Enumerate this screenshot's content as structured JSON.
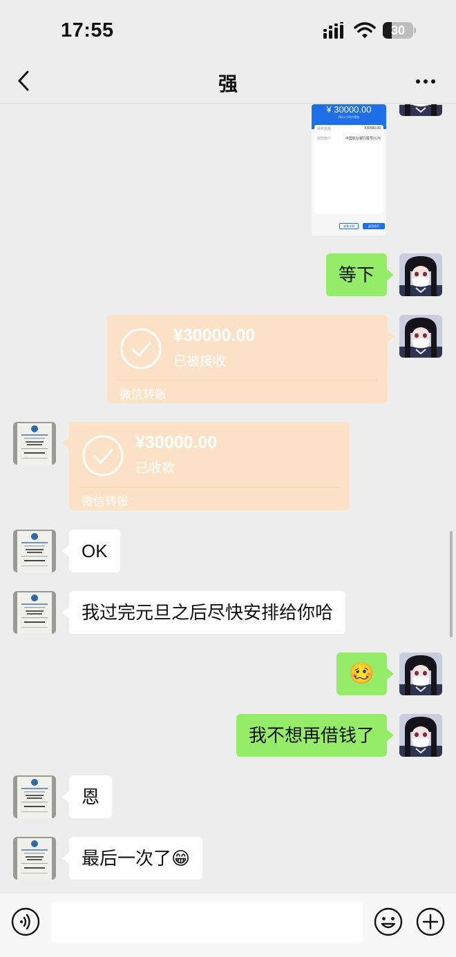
{
  "status_bar": {
    "time": "17:55",
    "battery": "30",
    "battery_level_percent": 30
  },
  "nav": {
    "title": "强"
  },
  "messages": {
    "m1": {
      "amount": "¥ 30000.00",
      "sub": "预计2小时内到账",
      "row1_label": "转账金额",
      "row1_value": "¥30000.00",
      "row2_label": "收款账户",
      "row2_value": "中国农业银行尾号0176",
      "btn1": "查看详情",
      "btn2": "返回首页"
    },
    "m2": {
      "text": "等下"
    },
    "m3": {
      "amount": "¥30000.00",
      "status": "已被接收",
      "brand": "微信转账"
    },
    "m4": {
      "amount": "¥30000.00",
      "status": "已收款",
      "brand": "微信转账"
    },
    "m5": {
      "text": "OK"
    },
    "m6": {
      "text": "我过完元旦之后尽快安排给你哈"
    },
    "m7": {
      "text": "🥴"
    },
    "m8": {
      "text": "我不想再借钱了"
    },
    "m9": {
      "text": "恩"
    },
    "m10": {
      "text": "最后一次了",
      "emoji": "😁"
    }
  },
  "input": {
    "value": "",
    "placeholder": ""
  },
  "colors": {
    "mine_bubble": "#95ec69",
    "theirs_bubble": "#ffffff",
    "transfer_card": "#fbe2c6",
    "background": "#ededed"
  }
}
